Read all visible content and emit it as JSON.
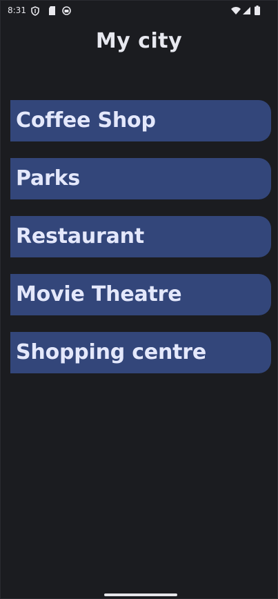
{
  "status_bar": {
    "time": "8:31",
    "left_icons": [
      "shield-icon",
      "sd-card-icon",
      "app-notification-icon"
    ],
    "right_icons": [
      "wifi-icon",
      "cellular-signal-icon",
      "battery-icon"
    ]
  },
  "app": {
    "title": "My city"
  },
  "categories": [
    {
      "label": "Coffee Shop"
    },
    {
      "label": "Parks"
    },
    {
      "label": "Restaurant"
    },
    {
      "label": "Movie Theatre"
    },
    {
      "label": "Shopping centre"
    }
  ],
  "colors": {
    "background": "#1b1c20",
    "card": "#33467a",
    "card_text": "#e4e8fb",
    "title_text": "#e7e8ef"
  }
}
